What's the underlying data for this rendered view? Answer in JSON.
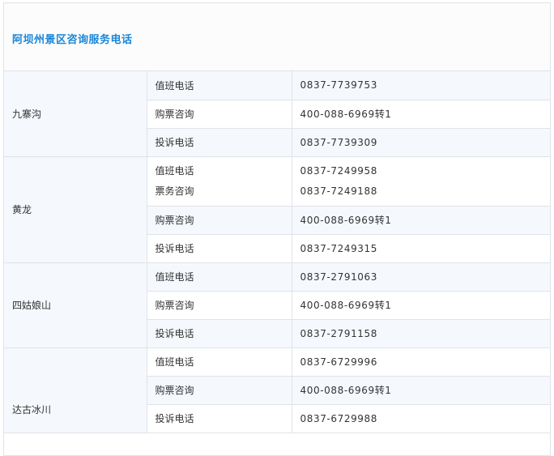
{
  "title": "阿坝州景区咨询服务电话",
  "scenic_spots": [
    {
      "name": "九寨沟",
      "rows": [
        {
          "types": [
            "值班电话"
          ],
          "numbers": [
            "0837-7739753"
          ]
        },
        {
          "types": [
            "购票咨询"
          ],
          "numbers": [
            "400-088-6969转1"
          ]
        },
        {
          "types": [
            "投诉电话"
          ],
          "numbers": [
            "0837-7739309"
          ]
        }
      ]
    },
    {
      "name": "黄龙",
      "rows": [
        {
          "types": [
            "值班电话",
            "票务咨询"
          ],
          "numbers": [
            "0837-7249958",
            "0837-7249188"
          ]
        },
        {
          "types": [
            "购票咨询"
          ],
          "numbers": [
            "400-088-6969转1"
          ]
        },
        {
          "types": [
            "投诉电话"
          ],
          "numbers": [
            "0837-7249315"
          ]
        }
      ]
    },
    {
      "name": "四姑娘山",
      "rows": [
        {
          "types": [
            "值班电话"
          ],
          "numbers": [
            "0837-2791063"
          ]
        },
        {
          "types": [
            "购票咨询"
          ],
          "numbers": [
            "400-088-6969转1"
          ]
        },
        {
          "types": [
            "投诉电话"
          ],
          "numbers": [
            "0837-2791158"
          ]
        }
      ]
    },
    {
      "name": "达古冰川",
      "rows": [
        {
          "types": [
            "值班电话"
          ],
          "numbers": [
            "0837-6729996"
          ]
        },
        {
          "types": [
            "购票咨询"
          ],
          "numbers": [
            "400-088-6969转1"
          ]
        },
        {
          "types": [
            "投诉电话"
          ],
          "numbers": [
            "0837-6729988"
          ]
        }
      ]
    }
  ]
}
